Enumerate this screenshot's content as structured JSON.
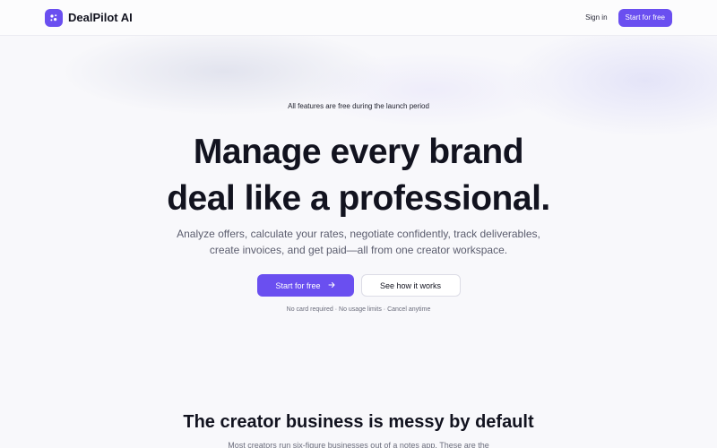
{
  "nav": {
    "brand_name": "DealPilot AI",
    "sign_in": "Sign in",
    "cta": "Start for free"
  },
  "hero": {
    "announcement": "All features are free during the launch period",
    "headline_line1": "Manage every brand",
    "headline_line2": "deal like a professional.",
    "subtext_line1": "Analyze offers, calculate your rates, negotiate confidently, track deliverables,",
    "subtext_line2": "create invoices, and get paid—all from one creator workspace.",
    "primary_cta": "Start for free",
    "secondary_cta": "See how it works",
    "reassurance": "No card required · No usage limits · Cancel anytime"
  },
  "section": {
    "title": "The creator business is messy by default",
    "subtitle": "Most creators run six-figure businesses out of a notes app. These are the"
  },
  "icons": {
    "logo": "sparkles-icon",
    "cta_arrow": "arrow-right-icon"
  },
  "colors": {
    "accent": "#6a4ff0",
    "text": "#12131f",
    "muted": "#5b5d6e",
    "background": "#f8f8fb"
  }
}
